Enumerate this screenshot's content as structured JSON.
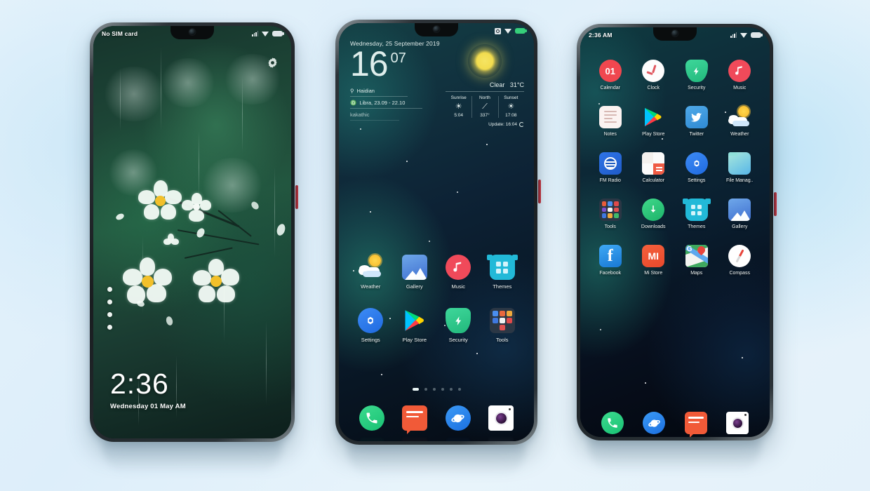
{
  "background_color": "#e2f0fa",
  "phone1": {
    "name": "lockscreen-phone",
    "status": {
      "carrier": "No SIM card",
      "icons": [
        "signal-icon",
        "wifi-icon",
        "battery-icon"
      ]
    },
    "settings_icon": "gear-icon",
    "page_dots": 4,
    "clock": {
      "time": "2:36",
      "date": "Wednesday 01 May  AM"
    },
    "wallpaper": "green-white-blossom"
  },
  "phone2": {
    "name": "homescreen-phone",
    "status": {
      "time": "",
      "icons": [
        "alarm-icon",
        "wifi-icon",
        "battery-icon"
      ]
    },
    "widget": {
      "date": "Wednesday, 25 September 2019",
      "hours": "16",
      "minutes": "07",
      "location": "Haidian",
      "zodiac": "Libra, 23.09 - 22.10",
      "author": "kakathic",
      "condition": "Clear",
      "temperature": "31°C",
      "cells": [
        {
          "label": "Sunrise",
          "glyph": "☀",
          "value": "5:04"
        },
        {
          "label": "North",
          "glyph": "⟋",
          "value": "337°"
        },
        {
          "label": "Sunset",
          "glyph": "☀",
          "value": "17:08"
        }
      ],
      "update": "Update: 16:04"
    },
    "apps": [
      {
        "label": "Weather",
        "icon": "weather-icon"
      },
      {
        "label": "Gallery",
        "icon": "gallery-icon"
      },
      {
        "label": "Music",
        "icon": "music-icon"
      },
      {
        "label": "Themes",
        "icon": "themes-icon"
      },
      {
        "label": "Settings",
        "icon": "settings-icon"
      },
      {
        "label": "Play Store",
        "icon": "play-store-icon"
      },
      {
        "label": "Security",
        "icon": "security-icon"
      },
      {
        "label": "Tools",
        "icon": "tools-folder-icon"
      }
    ],
    "dock": [
      {
        "label": "Phone",
        "icon": "phone-icon"
      },
      {
        "label": "Messaging",
        "icon": "messaging-icon"
      },
      {
        "label": "Browser",
        "icon": "browser-icon"
      },
      {
        "label": "Camera",
        "icon": "camera-icon"
      }
    ],
    "page_dots": {
      "count": 6,
      "active": 0
    }
  },
  "phone3": {
    "name": "app-drawer-phone",
    "status": {
      "time": "2:36 AM",
      "icons": [
        "signal-icon",
        "wifi-icon",
        "battery-icon"
      ]
    },
    "apps": [
      {
        "label": "Calendar",
        "icon": "calendar-icon",
        "badge": "01"
      },
      {
        "label": "Clock",
        "icon": "clock-icon"
      },
      {
        "label": "Security",
        "icon": "security-icon"
      },
      {
        "label": "Music",
        "icon": "music-icon"
      },
      {
        "label": "Notes",
        "icon": "notes-icon"
      },
      {
        "label": "Play Store",
        "icon": "play-store-icon"
      },
      {
        "label": "Twitter",
        "icon": "twitter-icon"
      },
      {
        "label": "Weather",
        "icon": "weather-icon"
      },
      {
        "label": "FM Radio",
        "icon": "fm-radio-icon"
      },
      {
        "label": "Calculator",
        "icon": "calculator-icon"
      },
      {
        "label": "Settings",
        "icon": "settings-icon"
      },
      {
        "label": "File Manag..",
        "icon": "file-manager-icon"
      },
      {
        "label": "Tools",
        "icon": "tools-folder-icon"
      },
      {
        "label": "Downloads",
        "icon": "downloads-icon"
      },
      {
        "label": "Themes",
        "icon": "themes-icon"
      },
      {
        "label": "Gallery",
        "icon": "gallery-icon"
      },
      {
        "label": "Facebook",
        "icon": "facebook-icon"
      },
      {
        "label": "Mi Store",
        "icon": "mi-store-icon"
      },
      {
        "label": "Maps",
        "icon": "maps-icon"
      },
      {
        "label": "Compass",
        "icon": "compass-icon"
      }
    ],
    "dock": [
      {
        "label": "Phone",
        "icon": "phone-icon"
      },
      {
        "label": "Browser",
        "icon": "browser-icon"
      },
      {
        "label": "Messaging",
        "icon": "messaging-icon"
      },
      {
        "label": "Camera",
        "icon": "camera-icon"
      }
    ]
  }
}
